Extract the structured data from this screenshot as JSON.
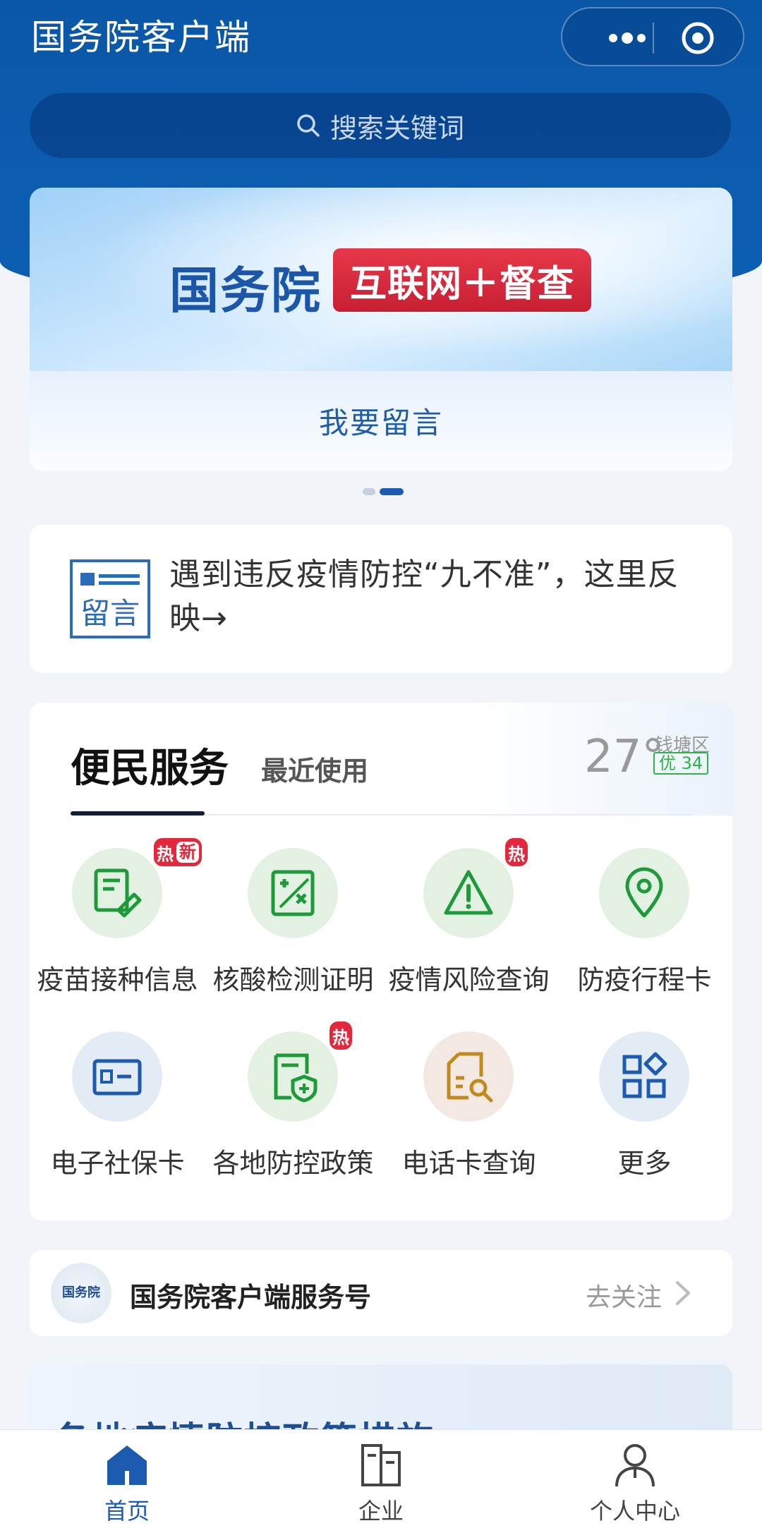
{
  "header": {
    "title": "国务院客户端"
  },
  "search": {
    "placeholder": "搜索关键词"
  },
  "banner": {
    "brand": "国务院",
    "tag": "互联网＋督查",
    "cta": "我要留言",
    "slides": 2,
    "active_slide": 2
  },
  "notice": {
    "icon_text": "留言",
    "text": "遇到违反疫情防控“九不准”，这里反映→"
  },
  "services": {
    "tab_main": "便民服务",
    "tab_recent": "最近使用",
    "weather": {
      "temperature": "27°",
      "district": "钱塘区",
      "aqi": "优 34"
    },
    "items": [
      {
        "label": "疫苗接种信息",
        "icon": "vaccine-icon",
        "badges": [
          "热",
          "新"
        ]
      },
      {
        "label": "核酸检测证明",
        "icon": "test-certificate-icon",
        "badges": []
      },
      {
        "label": "疫情风险查询",
        "icon": "warning-icon",
        "badges": [
          "热"
        ]
      },
      {
        "label": "防疫行程卡",
        "icon": "location-pin-icon",
        "badges": []
      },
      {
        "label": "电子社保卡",
        "icon": "id-card-icon",
        "badges": []
      },
      {
        "label": "各地防控政策",
        "icon": "shield-document-icon",
        "badges": [
          "热"
        ]
      },
      {
        "label": "电话卡查询",
        "icon": "sim-card-search-icon",
        "badges": []
      },
      {
        "label": "更多",
        "icon": "grid-more-icon",
        "badges": []
      }
    ],
    "colors": {
      "green": "#1f9a3a",
      "blue": "#1c5bb0",
      "gold": "#c08a1c",
      "hot": "#e3283d"
    }
  },
  "official": {
    "logo_text": "国务院",
    "name": "国务院客户端服务号",
    "follow": "去关注"
  },
  "peek": {
    "title": "各地疫情防控政策措施"
  },
  "tabbar": [
    {
      "label": "首页",
      "icon": "home-icon",
      "active": true
    },
    {
      "label": "企业",
      "icon": "building-icon",
      "active": false
    },
    {
      "label": "个人中心",
      "icon": "user-icon",
      "active": false
    }
  ]
}
